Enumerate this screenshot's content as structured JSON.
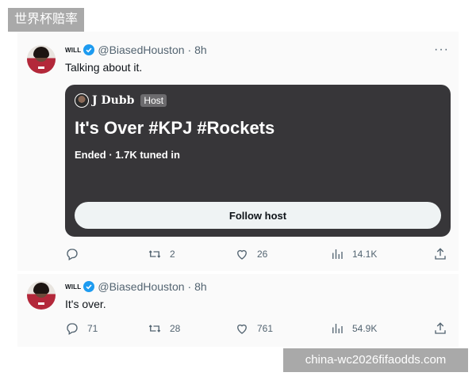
{
  "watermarks": {
    "top_left": "世界杯赔率",
    "bottom_right": "china-wc2026fifaodds.com"
  },
  "tweets": [
    {
      "display_name": "WILL",
      "handle": "@BiasedHouston",
      "time": "· 8h",
      "text": "Talking about it.",
      "space": {
        "host_name": "J Dubb",
        "host_badge": "Host",
        "title": "It's Over #KPJ #Rockets",
        "status": "Ended · 1.7K tuned in",
        "button": "Follow host"
      },
      "actions": {
        "reply": "",
        "retweet": "2",
        "like": "26",
        "views": "14.1K"
      }
    },
    {
      "display_name": "WILL",
      "handle": "@BiasedHouston",
      "time": "· 8h",
      "text": "It's over.",
      "actions": {
        "reply": "71",
        "retweet": "28",
        "like": "761",
        "views": "54.9K"
      }
    }
  ],
  "icons": {
    "verified": "verified-badge-icon",
    "more": "more-icon",
    "reply": "reply-icon",
    "retweet": "retweet-icon",
    "like": "like-icon",
    "views": "views-icon",
    "share": "share-icon"
  },
  "colors": {
    "verified": "#1d9bf0",
    "card_bg": "#373639",
    "muted_text": "#536471"
  }
}
